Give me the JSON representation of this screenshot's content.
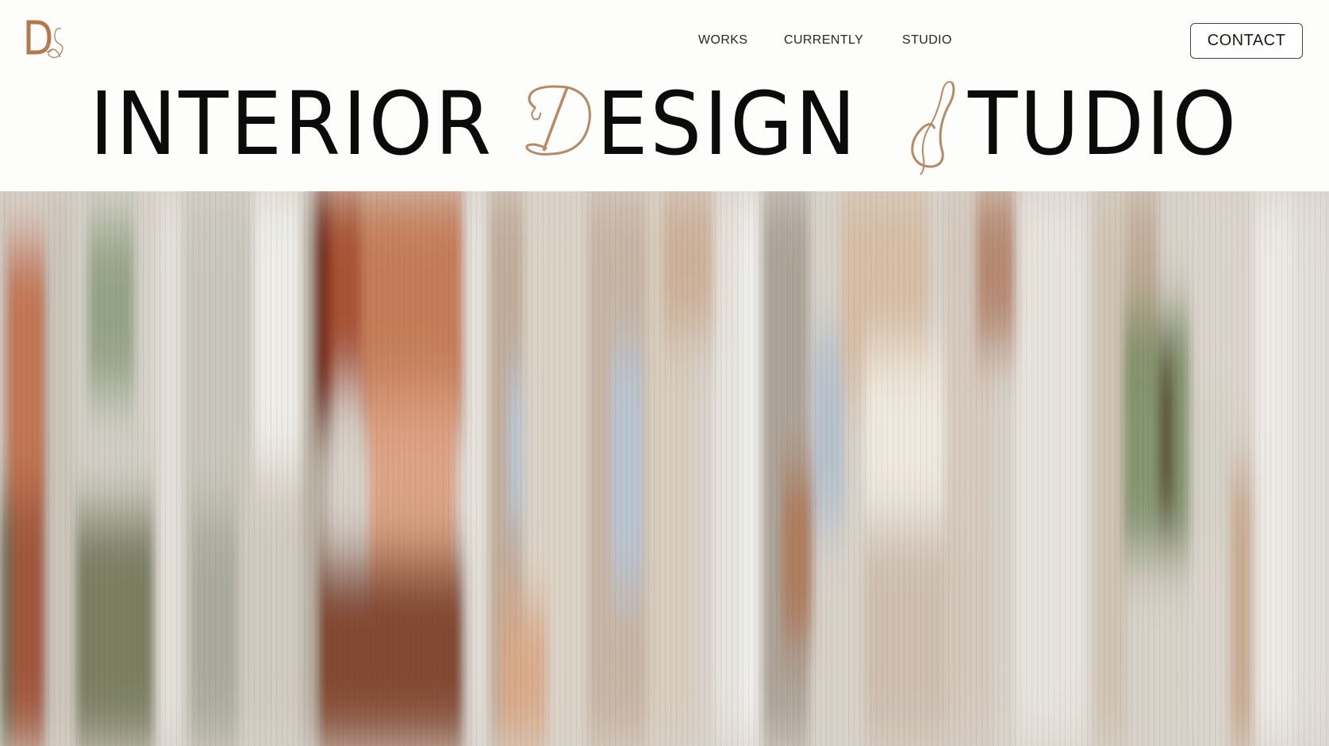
{
  "header": {
    "logo": {
      "letters": "DS",
      "icon": "ds-monogram-logo"
    },
    "nav": [
      {
        "label": "WORKS"
      },
      {
        "label": "CURRENTLY"
      },
      {
        "label": "STUDIO"
      }
    ],
    "contact_label": "CONTACT"
  },
  "hero": {
    "headline": {
      "word1": "INTERIOR",
      "word2_initial": "D",
      "word2_rest": "ESIGN",
      "word3_initial": "S",
      "word3_rest": "TUDIO"
    },
    "image": {
      "description": "abstract blurred vertical-stripe interior image",
      "icon": "hero-image"
    }
  },
  "colors": {
    "accent": "#b58a66",
    "text": "#0b0b0b",
    "background": "#fdfdfc"
  }
}
